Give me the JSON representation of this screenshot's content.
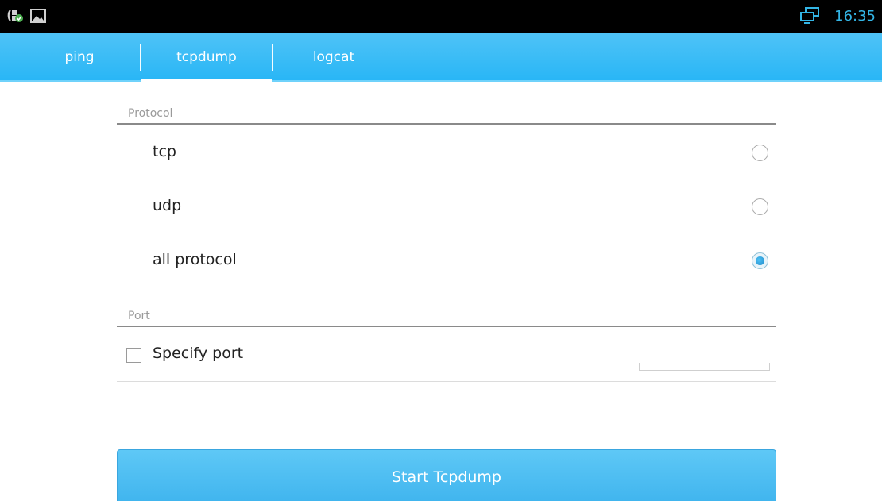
{
  "status_bar": {
    "time": "16:35",
    "accent_color": "#33b5e5",
    "left_icons": [
      "phone-check-icon",
      "image-icon"
    ],
    "right_icons": [
      "screen-mirror-icon"
    ]
  },
  "tabs": [
    {
      "label": "ping",
      "selected": false
    },
    {
      "label": "tcpdump",
      "selected": true
    },
    {
      "label": "logcat",
      "selected": false
    }
  ],
  "protocol": {
    "header": "Protocol",
    "options": [
      {
        "label": "tcp",
        "checked": false
      },
      {
        "label": "udp",
        "checked": false
      },
      {
        "label": "all protocol",
        "checked": true
      }
    ]
  },
  "port": {
    "header": "Port",
    "specify_label": "Specify port",
    "specify_checked": false,
    "value": ""
  },
  "start_button": {
    "label": "Start Tcpdump"
  },
  "colors": {
    "tab_bar": "#29b6f6",
    "button": "#4fc3f7",
    "radio_selected": "#1e88c7"
  }
}
